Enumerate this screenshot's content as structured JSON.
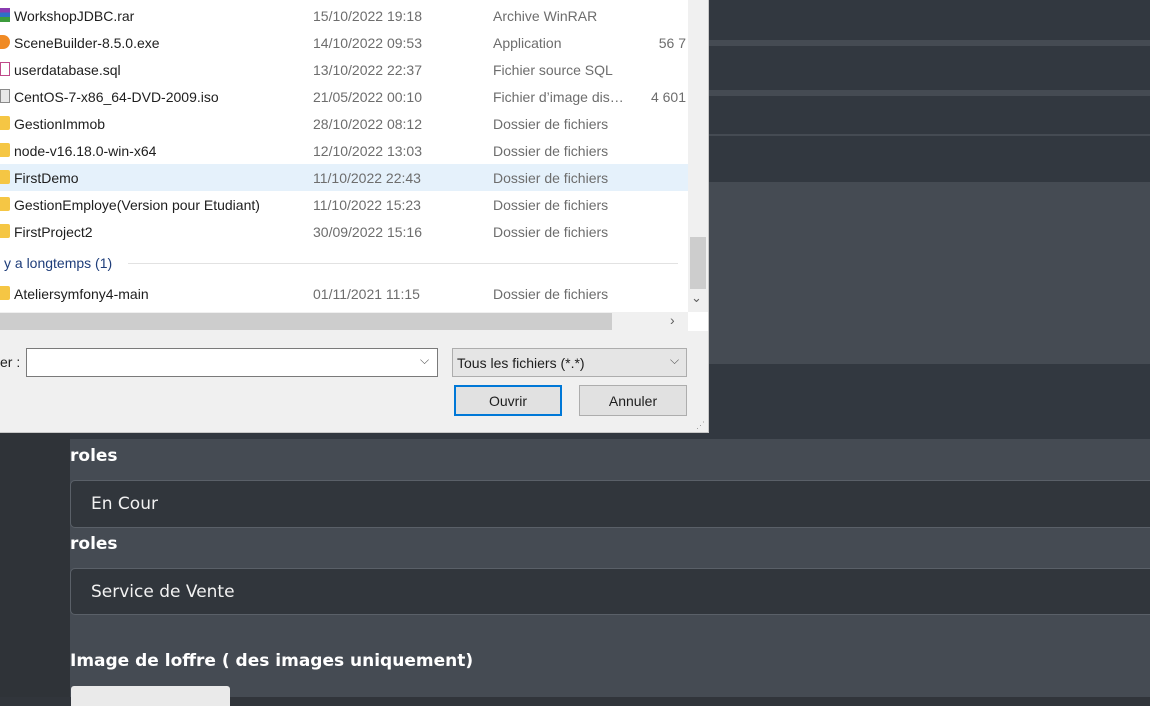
{
  "files": [
    {
      "name": "WorkshopJDBC.rar",
      "date": "15/10/2022 19:18",
      "type": "Archive WinRAR",
      "size": "",
      "icon": "winrar-archive-icon"
    },
    {
      "name": "SceneBuilder-8.5.0.exe",
      "date": "14/10/2022 09:53",
      "type": "Application",
      "size": "56 7",
      "icon": "application-icon"
    },
    {
      "name": "userdatabase.sql",
      "date": "13/10/2022 22:37",
      "type": "Fichier source SQL",
      "size": "",
      "icon": "sql-file-icon"
    },
    {
      "name": "CentOS-7-x86_64-DVD-2009.iso",
      "date": "21/05/2022 00:10",
      "type": "Fichier d’image dis…",
      "size": "4 601",
      "icon": "disk-image-icon"
    },
    {
      "name": "GestionImmob",
      "date": "28/10/2022 08:12",
      "type": "Dossier de fichiers",
      "size": "",
      "icon": "folder-icon"
    },
    {
      "name": "node-v16.18.0-win-x64",
      "date": "12/10/2022 13:03",
      "type": "Dossier de fichiers",
      "size": "",
      "icon": "folder-icon"
    },
    {
      "name": "FirstDemo",
      "date": "11/10/2022 22:43",
      "type": "Dossier de fichiers",
      "size": "",
      "icon": "folder-icon",
      "selected": true
    },
    {
      "name": "GestionEmploye(Version pour Etudiant)",
      "date": "11/10/2022 15:23",
      "type": "Dossier de fichiers",
      "size": "",
      "icon": "folder-icon"
    },
    {
      "name": "FirstProject2",
      "date": "30/09/2022 15:16",
      "type": "Dossier de fichiers",
      "size": "",
      "icon": "folder-icon"
    }
  ],
  "group_header": "y a longtemps (1)",
  "older_files": [
    {
      "name": "Ateliersymfony4-main",
      "date": "01/11/2021 11:15",
      "type": "Dossier de fichiers",
      "size": "",
      "icon": "folder-icon"
    }
  ],
  "dialog": {
    "filename_label": "er :",
    "filename_value": "",
    "filetype": "Tous les fichiers (*.*)",
    "open_label": "Ouvrir",
    "cancel_label": "Annuler"
  },
  "form": {
    "roles_label_1": "roles",
    "roles_value_1": "En Cour",
    "roles_label_2": "roles",
    "roles_value_2": "Service de Vente",
    "image_label": "Image de loffre ( des images uniquement)"
  }
}
